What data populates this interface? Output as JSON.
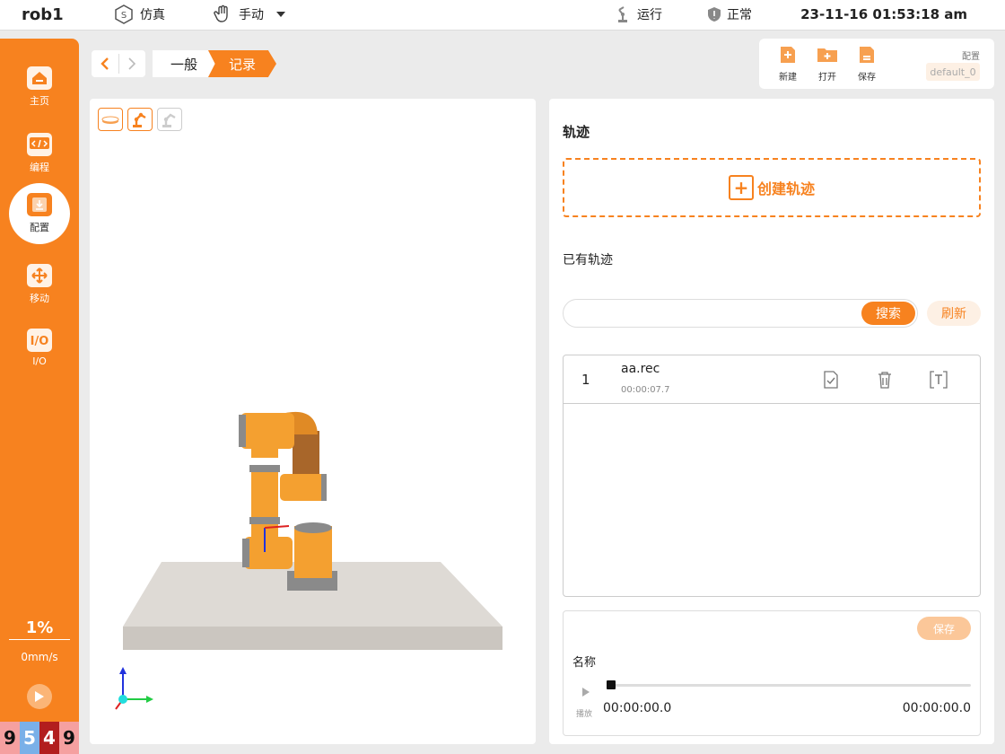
{
  "topbar": {
    "robot_name": "rob1",
    "sim_label": "仿真",
    "mode_label": "手动",
    "run_label": "运行",
    "status_label": "正常",
    "datetime": "23-11-16 01:53:18 am"
  },
  "sidebar": {
    "items": [
      {
        "label": "主页",
        "icon": "home-icon"
      },
      {
        "label": "编程",
        "icon": "code-icon"
      },
      {
        "label": "配置",
        "icon": "config-icon",
        "active": true
      },
      {
        "label": "移动",
        "icon": "move-icon"
      },
      {
        "label": "I/O",
        "icon": "io-icon"
      }
    ],
    "speed_percent": "1%",
    "speed_mm": "0mm/s",
    "digits": [
      "9",
      "5",
      "4",
      "9"
    ]
  },
  "breadcrumb": {
    "items": [
      "一般",
      "记录"
    ]
  },
  "file_toolbar": {
    "new_label": "新建",
    "open_label": "打开",
    "save_label": "保存",
    "config_label": "配置",
    "config_value": "default_0"
  },
  "trajectory": {
    "title": "轨迹",
    "create_label": "创建轨迹",
    "existing_label": "已有轨迹",
    "search_placeholder": "",
    "search_label": "搜索",
    "refresh_label": "刷新",
    "tracks": [
      {
        "index": "1",
        "name": "aa.rec",
        "duration": "00:00:07.7"
      }
    ]
  },
  "player": {
    "save_label": "保存",
    "name_label": "名称",
    "play_label": "播放",
    "progress": 0,
    "time_start": "00:00:00.0",
    "time_end": "00:00:00.0"
  },
  "colors": {
    "accent": "#f7821f",
    "accent_light": "#fdf0e4",
    "digit_colors": [
      "#f5a0a0",
      "#7ab0e8",
      "#b21e1e",
      "#f5a0a0"
    ]
  }
}
